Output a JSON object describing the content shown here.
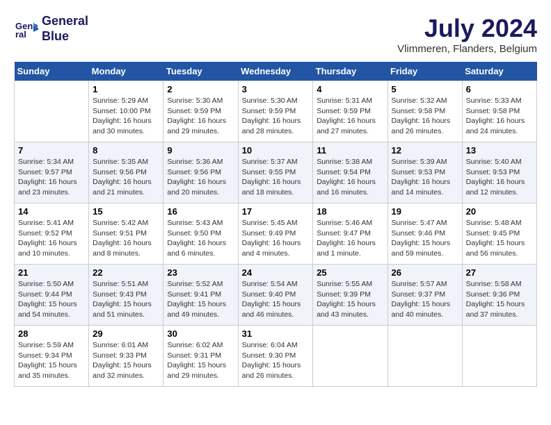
{
  "header": {
    "logo_line1": "General",
    "logo_line2": "Blue",
    "month_year": "July 2024",
    "location": "Vlimmeren, Flanders, Belgium"
  },
  "days_of_week": [
    "Sunday",
    "Monday",
    "Tuesday",
    "Wednesday",
    "Thursday",
    "Friday",
    "Saturday"
  ],
  "weeks": [
    [
      {
        "day": "",
        "info": ""
      },
      {
        "day": "1",
        "info": "Sunrise: 5:29 AM\nSunset: 10:00 PM\nDaylight: 16 hours\nand 30 minutes."
      },
      {
        "day": "2",
        "info": "Sunrise: 5:30 AM\nSunset: 9:59 PM\nDaylight: 16 hours\nand 29 minutes."
      },
      {
        "day": "3",
        "info": "Sunrise: 5:30 AM\nSunset: 9:59 PM\nDaylight: 16 hours\nand 28 minutes."
      },
      {
        "day": "4",
        "info": "Sunrise: 5:31 AM\nSunset: 9:59 PM\nDaylight: 16 hours\nand 27 minutes."
      },
      {
        "day": "5",
        "info": "Sunrise: 5:32 AM\nSunset: 9:58 PM\nDaylight: 16 hours\nand 26 minutes."
      },
      {
        "day": "6",
        "info": "Sunrise: 5:33 AM\nSunset: 9:58 PM\nDaylight: 16 hours\nand 24 minutes."
      }
    ],
    [
      {
        "day": "7",
        "info": "Sunrise: 5:34 AM\nSunset: 9:57 PM\nDaylight: 16 hours\nand 23 minutes."
      },
      {
        "day": "8",
        "info": "Sunrise: 5:35 AM\nSunset: 9:56 PM\nDaylight: 16 hours\nand 21 minutes."
      },
      {
        "day": "9",
        "info": "Sunrise: 5:36 AM\nSunset: 9:56 PM\nDaylight: 16 hours\nand 20 minutes."
      },
      {
        "day": "10",
        "info": "Sunrise: 5:37 AM\nSunset: 9:55 PM\nDaylight: 16 hours\nand 18 minutes."
      },
      {
        "day": "11",
        "info": "Sunrise: 5:38 AM\nSunset: 9:54 PM\nDaylight: 16 hours\nand 16 minutes."
      },
      {
        "day": "12",
        "info": "Sunrise: 5:39 AM\nSunset: 9:53 PM\nDaylight: 16 hours\nand 14 minutes."
      },
      {
        "day": "13",
        "info": "Sunrise: 5:40 AM\nSunset: 9:53 PM\nDaylight: 16 hours\nand 12 minutes."
      }
    ],
    [
      {
        "day": "14",
        "info": "Sunrise: 5:41 AM\nSunset: 9:52 PM\nDaylight: 16 hours\nand 10 minutes."
      },
      {
        "day": "15",
        "info": "Sunrise: 5:42 AM\nSunset: 9:51 PM\nDaylight: 16 hours\nand 8 minutes."
      },
      {
        "day": "16",
        "info": "Sunrise: 5:43 AM\nSunset: 9:50 PM\nDaylight: 16 hours\nand 6 minutes."
      },
      {
        "day": "17",
        "info": "Sunrise: 5:45 AM\nSunset: 9:49 PM\nDaylight: 16 hours\nand 4 minutes."
      },
      {
        "day": "18",
        "info": "Sunrise: 5:46 AM\nSunset: 9:47 PM\nDaylight: 16 hours\nand 1 minute."
      },
      {
        "day": "19",
        "info": "Sunrise: 5:47 AM\nSunset: 9:46 PM\nDaylight: 15 hours\nand 59 minutes."
      },
      {
        "day": "20",
        "info": "Sunrise: 5:48 AM\nSunset: 9:45 PM\nDaylight: 15 hours\nand 56 minutes."
      }
    ],
    [
      {
        "day": "21",
        "info": "Sunrise: 5:50 AM\nSunset: 9:44 PM\nDaylight: 15 hours\nand 54 minutes."
      },
      {
        "day": "22",
        "info": "Sunrise: 5:51 AM\nSunset: 9:43 PM\nDaylight: 15 hours\nand 51 minutes."
      },
      {
        "day": "23",
        "info": "Sunrise: 5:52 AM\nSunset: 9:41 PM\nDaylight: 15 hours\nand 49 minutes."
      },
      {
        "day": "24",
        "info": "Sunrise: 5:54 AM\nSunset: 9:40 PM\nDaylight: 15 hours\nand 46 minutes."
      },
      {
        "day": "25",
        "info": "Sunrise: 5:55 AM\nSunset: 9:39 PM\nDaylight: 15 hours\nand 43 minutes."
      },
      {
        "day": "26",
        "info": "Sunrise: 5:57 AM\nSunset: 9:37 PM\nDaylight: 15 hours\nand 40 minutes."
      },
      {
        "day": "27",
        "info": "Sunrise: 5:58 AM\nSunset: 9:36 PM\nDaylight: 15 hours\nand 37 minutes."
      }
    ],
    [
      {
        "day": "28",
        "info": "Sunrise: 5:59 AM\nSunset: 9:34 PM\nDaylight: 15 hours\nand 35 minutes."
      },
      {
        "day": "29",
        "info": "Sunrise: 6:01 AM\nSunset: 9:33 PM\nDaylight: 15 hours\nand 32 minutes."
      },
      {
        "day": "30",
        "info": "Sunrise: 6:02 AM\nSunset: 9:31 PM\nDaylight: 15 hours\nand 29 minutes."
      },
      {
        "day": "31",
        "info": "Sunrise: 6:04 AM\nSunset: 9:30 PM\nDaylight: 15 hours\nand 26 minutes."
      },
      {
        "day": "",
        "info": ""
      },
      {
        "day": "",
        "info": ""
      },
      {
        "day": "",
        "info": ""
      }
    ]
  ]
}
